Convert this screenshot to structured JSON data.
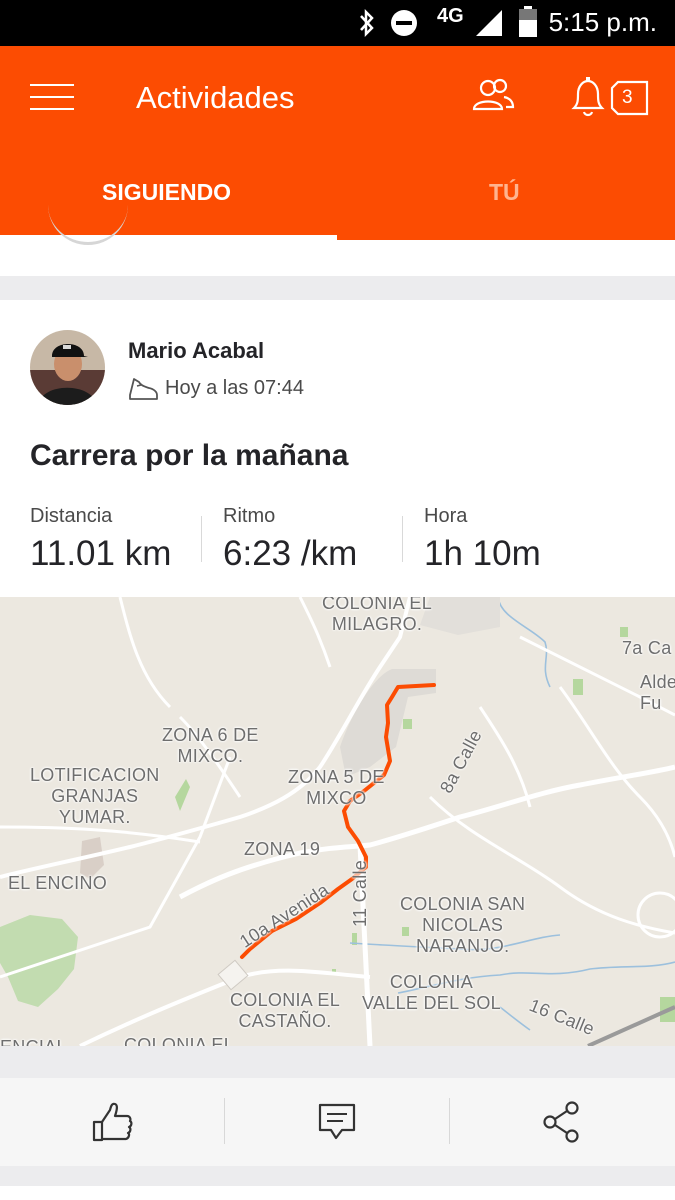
{
  "status_bar": {
    "network": "4G",
    "time": "5:15 p.m.",
    "icons": [
      "bluetooth-icon",
      "do-not-disturb-icon",
      "signal-icon",
      "battery-icon"
    ]
  },
  "app_bar": {
    "title": "Actividades",
    "notification_count": "3",
    "icons": [
      "menu-icon",
      "friends-icon",
      "bell-icon"
    ],
    "accent_color": "#fc4c02"
  },
  "tabs": [
    {
      "label": "SIGUIENDO",
      "active": true
    },
    {
      "label": "TÚ",
      "active": false
    }
  ],
  "activity": {
    "athlete": "Mario Acabal",
    "timestamp": "Hoy a las 07:44",
    "type_icon": "shoe-icon",
    "title": "Carrera por la mañana",
    "stats": [
      {
        "label": "Distancia",
        "value": "11.01 km"
      },
      {
        "label": "Ritmo",
        "value": "6:23 /km"
      },
      {
        "label": "Hora",
        "value": "1h 10m"
      }
    ]
  },
  "map": {
    "route_color": "#fc4c02",
    "labels": [
      "COLONIA EL\nMILAGRO.",
      "7a Ca",
      "Alde\nFu",
      "ZONA 6 DE\nMIXCO.",
      "LOTIFICACION\nGRANJAS\nYUMAR.",
      "ZONA 5 DE\nMIXCO",
      "8a Calle",
      "ZONA 19",
      "EL ENCINO",
      "10a Avenida",
      "11 Calle",
      "COLONIA SAN\nNICOLAS\nNARANJO.",
      "COLONIA\nVALLE DEL SOL",
      "COLONIA EL\nCASTAÑO.",
      "16 Calle",
      "COLONIA EL",
      "ENCIAL"
    ]
  },
  "actions": {
    "icons": [
      "thumbs-up-icon",
      "comment-icon",
      "share-icon"
    ]
  }
}
